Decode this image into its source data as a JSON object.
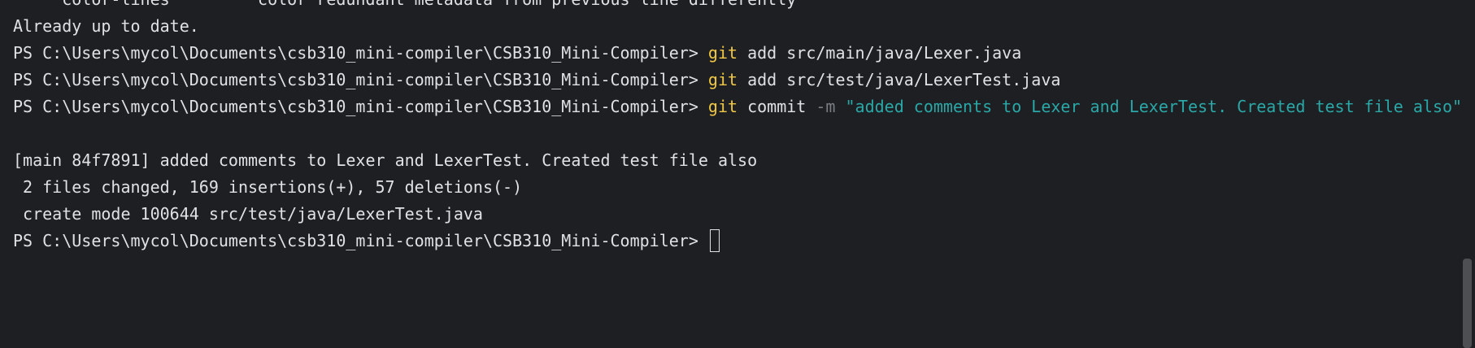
{
  "lines": {
    "cutoff": "     color-lines         color redundant metadata from previous line differently",
    "up_to_date": "Already up to date.",
    "add_lexer": {
      "prompt": "PS C:\\Users\\mycol\\Documents\\csb310_mini-compiler\\CSB310_Mini-Compiler> ",
      "cmd": "git",
      "args": " add src/main/java/Lexer.java"
    },
    "add_lexer_test": {
      "prompt": "PS C:\\Users\\mycol\\Documents\\csb310_mini-compiler\\CSB310_Mini-Compiler> ",
      "cmd": "git",
      "args": " add src/test/java/LexerTest.java"
    },
    "commit": {
      "prompt": "PS C:\\Users\\mycol\\Documents\\csb310_mini-compiler\\CSB310_Mini-Compiler> ",
      "cmd": "git",
      "sub": " commit ",
      "flag": "-m",
      "message": " \"added comments to Lexer and LexerTest. Created test file also\""
    },
    "commit_result": "[main 84f7891] added comments to Lexer and LexerTest. Created test file also",
    "stats": " 2 files changed, 169 insertions(+), 57 deletions(-)",
    "create_mode": " create mode 100644 src/test/java/LexerTest.java",
    "final_prompt": "PS C:\\Users\\mycol\\Documents\\csb310_mini-compiler\\CSB310_Mini-Compiler> "
  },
  "colors": {
    "background": "#1e1f22",
    "text": "#dfe1e5",
    "command": "#f0c846",
    "flag": "#7a7e85",
    "string": "#2aa8a8"
  }
}
